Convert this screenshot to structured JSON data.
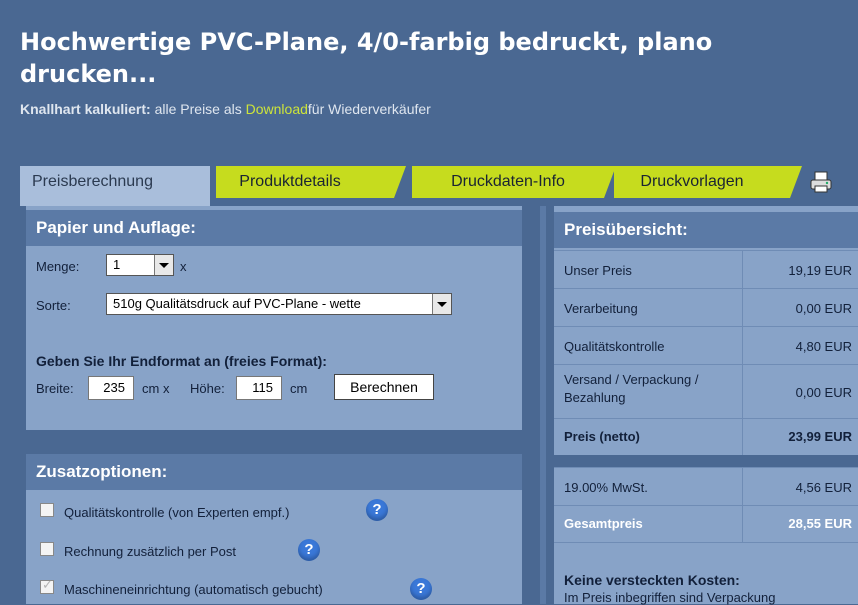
{
  "page": {
    "title": "Hochwertige PVC-Plane, 4/0-farbig bedruckt, plano drucken...",
    "sub_bold": "Knallhart kalkuliert:",
    "sub_text1": "alle Preise als",
    "sub_link": "Download",
    "sub_text2": "für Wiederverkäufer"
  },
  "tabs": [
    {
      "label": "Preisberechnung"
    },
    {
      "label": "Produktdetails"
    },
    {
      "label": "Druckdaten-Info"
    },
    {
      "label": "Druckvorlagen"
    }
  ],
  "paper": {
    "heading": "Papier und Auflage:",
    "menge_label": "Menge:",
    "menge_value": "1",
    "menge_suffix": "x",
    "sorte_label": "Sorte:",
    "sorte_value": "510g Qualitätsdruck auf PVC-Plane - wette",
    "format_heading": "Geben Sie Ihr Endformat an (freies Format):",
    "breite_label": "Breite:",
    "breite_value": "235",
    "breite_unit": "cm x",
    "hoehe_label": "Höhe:",
    "hoehe_value": "115",
    "hoehe_unit": "cm",
    "calc_button": "Berechnen"
  },
  "extras": {
    "heading": "Zusatzoptionen:",
    "options": [
      {
        "label": "Qualitätskontrolle (von Experten empf.)",
        "checked": false
      },
      {
        "label": "Rechnung zusätzlich per Post",
        "checked": false
      },
      {
        "label": "Maschineneinrichtung (automatisch gebucht)",
        "checked": true
      }
    ],
    "help_glyph": "?"
  },
  "prices": {
    "heading": "Preisübersicht:",
    "rows": [
      {
        "label": "Unser Preis",
        "value": "19,19 EUR"
      },
      {
        "label": "Verarbeitung",
        "value": "0,00 EUR"
      },
      {
        "label": "Qualitätskontrolle",
        "value": "4,80 EUR"
      },
      {
        "label": "Versand / Verpackung / Bezahlung",
        "value": "0,00 EUR"
      },
      {
        "label": "Preis (netto)",
        "value": "23,99 EUR"
      },
      {
        "label": "19.00% MwSt.",
        "value": "4,56 EUR"
      },
      {
        "label": "Gesamtpreis",
        "value": "28,55 EUR"
      }
    ],
    "note_heading": "Keine versteckten Kosten:",
    "note_text": "Im Preis inbegriffen sind Verpackung"
  },
  "colors": {
    "accent": "#c6dc1e",
    "panel": "#88a3c8",
    "header": "#5b7aa6",
    "background": "#4a6892"
  },
  "icons": {
    "print": "printer-icon",
    "help": "help-icon"
  }
}
